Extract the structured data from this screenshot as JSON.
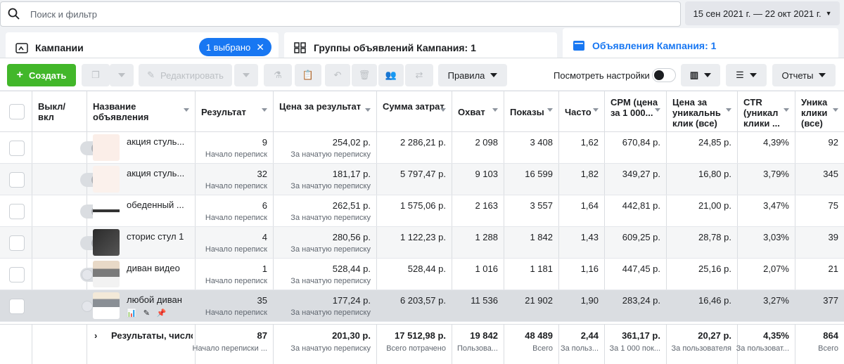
{
  "search": {
    "placeholder": "Поиск и фильтр"
  },
  "date_range": "15 сен 2021 г. — 22 окт 2021 г.",
  "tabs": {
    "campaigns": "Кампании",
    "selected_badge": "1 выбрано",
    "adsets": "Группы объявлений Кампания: 1",
    "ads": "Объявления Кампания: 1"
  },
  "toolbar": {
    "create": "Создать",
    "edit": "Редактировать",
    "rules": "Правила",
    "view_settings": "Посмотреть настройки",
    "reports": "Отчеты"
  },
  "columns": [
    "Выкл/ вкл",
    "Название объявления",
    "Результат",
    "Цена за результат",
    "Сумма затрат",
    "Охват",
    "Показы",
    "Часто",
    "CPM (цена за 1 000...",
    "Цена за уникальнь клик (все)",
    "CTR (уникал клики ...",
    "Уника клики (все)"
  ],
  "rows": [
    {
      "name": "акция стуль...",
      "result": "9",
      "result_sub": "Начало переписк",
      "cpr": "254,02 р.",
      "cpr_sub": "За начатую переписку",
      "spend": "2 286,21 р.",
      "reach": "2 098",
      "impr": "3 408",
      "freq": "1,62",
      "cpm": "670,84 р.",
      "cpc": "24,85 р.",
      "ctr": "4,39%",
      "uniq": "92",
      "on": true
    },
    {
      "name": "акция стуль...",
      "result": "32",
      "result_sub": "Начало переписк",
      "cpr": "181,17 р.",
      "cpr_sub": "За начатую переписку",
      "spend": "5 797,47 р.",
      "reach": "9 103",
      "impr": "16 599",
      "freq": "1,82",
      "cpm": "349,27 р.",
      "cpc": "16,80 р.",
      "ctr": "3,79%",
      "uniq": "345",
      "on": true
    },
    {
      "name": "обеденный ...",
      "result": "6",
      "result_sub": "Начало переписк",
      "cpr": "262,51 р.",
      "cpr_sub": "За начатую переписку",
      "spend": "1 575,06 р.",
      "reach": "2 163",
      "impr": "3 557",
      "freq": "1,64",
      "cpm": "442,81 р.",
      "cpc": "21,00 р.",
      "ctr": "3,47%",
      "uniq": "75",
      "on": true
    },
    {
      "name": "сторис стул 1",
      "result": "4",
      "result_sub": "Начало переписк",
      "cpr": "280,56 р.",
      "cpr_sub": "За начатую переписку",
      "spend": "1 122,23 р.",
      "reach": "1 288",
      "impr": "1 842",
      "freq": "1,43",
      "cpm": "609,25 р.",
      "cpc": "28,78 р.",
      "ctr": "3,03%",
      "uniq": "39",
      "on": true
    },
    {
      "name": "диван видео",
      "result": "1",
      "result_sub": "Начало переписк",
      "cpr": "528,44 р.",
      "cpr_sub": "За начатую переписку",
      "spend": "528,44 р.",
      "reach": "1 016",
      "impr": "1 181",
      "freq": "1,16",
      "cpm": "447,45 р.",
      "cpc": "25,16 р.",
      "ctr": "2,07%",
      "uniq": "21",
      "on": false
    },
    {
      "name": "любой диван",
      "result": "35",
      "result_sub": "Начало переписк",
      "cpr": "177,24 р.",
      "cpr_sub": "За начатую переписку",
      "spend": "6 203,57 р.",
      "reach": "11 536",
      "impr": "21 902",
      "freq": "1,90",
      "cpm": "283,24 р.",
      "cpc": "16,46 р.",
      "ctr": "3,27%",
      "uniq": "377",
      "on": false
    }
  ],
  "totals": {
    "label": "Результаты, число",
    "result": "87",
    "result_sub": "Начало переписки ...",
    "cpr": "201,30 р.",
    "cpr_sub": "За начатую переписку",
    "spend": "17 512,98 р.",
    "spend_sub": "Всего потрачено",
    "reach": "19 842",
    "reach_sub": "Пользова...",
    "impr": "48 489",
    "impr_sub": "Всего",
    "freq": "2,44",
    "freq_sub": "За польз...",
    "cpm": "361,17 р.",
    "cpm_sub": "За 1 000 пок...",
    "cpc": "20,27 р.",
    "cpc_sub": "За пользователя",
    "ctr": "4,35%",
    "ctr_sub": "За пользоват...",
    "uniq": "864",
    "uniq_sub": "Всего"
  }
}
